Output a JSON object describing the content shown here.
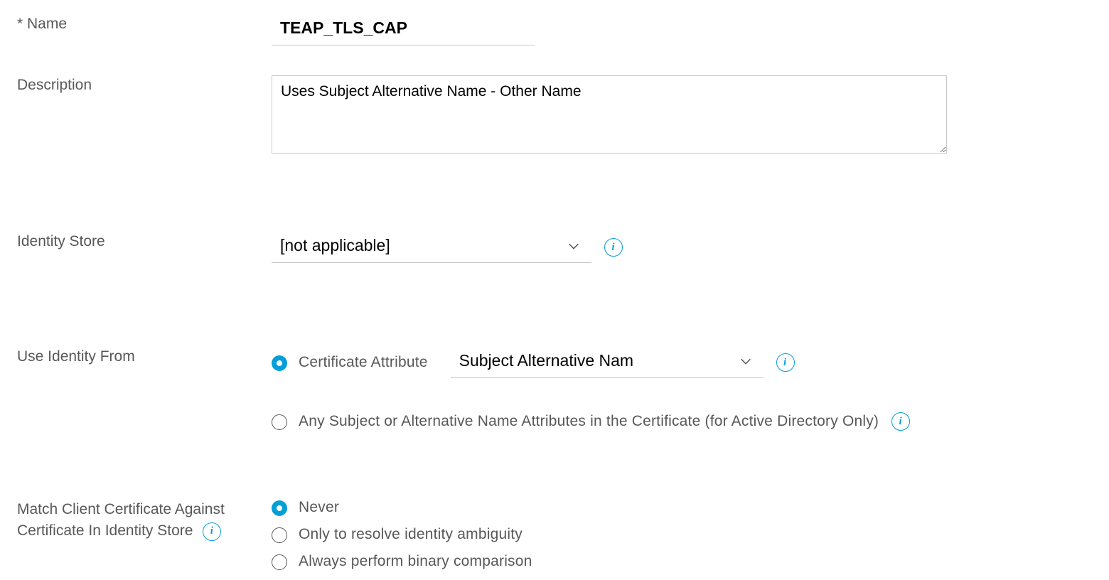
{
  "name": {
    "label": "* Name",
    "value": "TEAP_TLS_CAP"
  },
  "description": {
    "label": "Description",
    "value": "Uses Subject Alternative Name - Other Name"
  },
  "identity_store": {
    "label": "Identity Store",
    "value": "[not applicable]"
  },
  "use_identity_from": {
    "label": "Use Identity From",
    "options": {
      "cert_attr": {
        "label": "Certificate Attribute",
        "selected": true,
        "attribute_value": "Subject Alternative Nam"
      },
      "any_subject": {
        "label": "Any Subject or Alternative Name Attributes in the Certificate (for Active Directory Only)",
        "selected": false
      }
    }
  },
  "match_client_cert": {
    "label": "Match Client Certificate Against Certificate In Identity Store",
    "options": [
      {
        "label": "Never",
        "selected": true
      },
      {
        "label": "Only to resolve identity ambiguity",
        "selected": false
      },
      {
        "label": "Always perform binary comparison",
        "selected": false
      }
    ]
  }
}
